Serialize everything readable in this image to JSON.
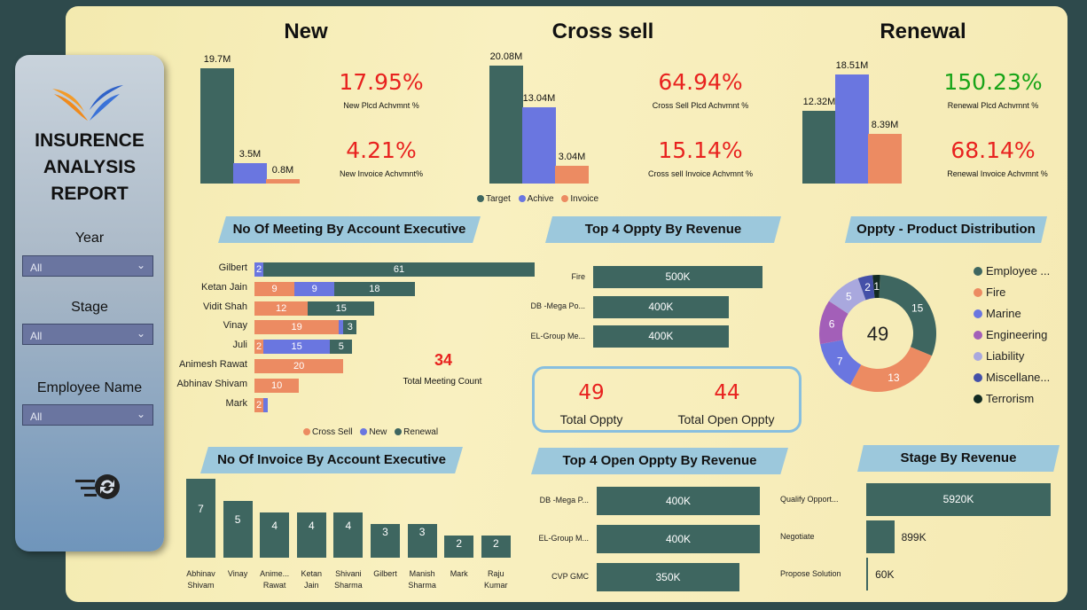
{
  "sidebar": {
    "title_lines": [
      "INSURENCE",
      "ANALYSIS",
      "REPORT"
    ],
    "filters": [
      {
        "label": "Year",
        "value": "All"
      },
      {
        "label": "Stage",
        "value": "All"
      },
      {
        "label": "Employee Name",
        "value": "All"
      }
    ],
    "logo_icon": "phoenix-logo",
    "reset_icon": "filter-reset-icon"
  },
  "kpi_sections": [
    {
      "title": "New",
      "bars": [
        {
          "label": "19.7M",
          "value": 19.7
        },
        {
          "label": "3.5M",
          "value": 3.5
        },
        {
          "label": "0.8M",
          "value": 0.8
        }
      ],
      "pct1": "17.95%",
      "pct1_label": "New Plcd Achvmnt %",
      "pct2": "4.21%",
      "pct2_label": "New Invoice Achvmnt%"
    },
    {
      "title": "Cross sell",
      "bars": [
        {
          "label": "20.08M",
          "value": 20.08
        },
        {
          "label": "13.04M",
          "value": 13.04
        },
        {
          "label": "3.04M",
          "value": 3.04
        }
      ],
      "pct1": "64.94%",
      "pct1_label": "Cross Sell Plcd Achvmnt %",
      "pct2": "15.14%",
      "pct2_label": "Cross sell Invoice Achvmnt %"
    },
    {
      "title": "Renewal",
      "bars": [
        {
          "label": "12.32M",
          "value": 12.32
        },
        {
          "label": "18.51M",
          "value": 18.51
        },
        {
          "label": "8.39M",
          "value": 8.39
        }
      ],
      "pct1": "150.23%",
      "pct1_label": "Renewal Plcd Achvmnt %",
      "pct2": "68.14%",
      "pct2_label": "Renewal Invoice Achvmnt %"
    }
  ],
  "kpi_legend": [
    "Target",
    "Achive",
    "Invoice"
  ],
  "colors": {
    "teal": "#3e6660",
    "blue": "#6a76e0",
    "orange": "#ec8b62",
    "red": "#e8221f",
    "green": "#18a418"
  },
  "meetings": {
    "title": "No Of Meeting By Account Executive",
    "rows": [
      {
        "name": "Gilbert",
        "cross": 0,
        "new": 2,
        "renewal": 61
      },
      {
        "name": "Ketan Jain",
        "cross": 9,
        "new": 9,
        "renewal": 18
      },
      {
        "name": "Vidit Shah",
        "cross": 12,
        "new": 0,
        "renewal": 15
      },
      {
        "name": "Vinay",
        "cross": 19,
        "new": 1,
        "renewal": 3
      },
      {
        "name": "Juli",
        "cross": 2,
        "new": 15,
        "renewal": 5
      },
      {
        "name": "Animesh Rawat",
        "cross": 20,
        "new": 0,
        "renewal": 0
      },
      {
        "name": "Abhinav Shivam",
        "cross": 10,
        "new": 0,
        "renewal": 0
      },
      {
        "name": "Mark",
        "cross": 2,
        "new": 1,
        "renewal": 0
      }
    ],
    "legend": [
      "Cross Sell",
      "New",
      "Renewal"
    ],
    "total": "34",
    "total_label": "Total Meeting Count"
  },
  "top4": {
    "title": "Top 4 Oppty By Revenue",
    "rows": [
      {
        "name": "Fire",
        "label": "500K",
        "value": 500
      },
      {
        "name": "DB -Mega Po...",
        "label": "400K",
        "value": 400
      },
      {
        "name": "EL-Group Me...",
        "label": "400K",
        "value": 400
      }
    ]
  },
  "oppty_card": {
    "total": "49",
    "total_label": "Total Oppty",
    "open": "44",
    "open_label": "Total Open Oppty"
  },
  "donut": {
    "title": "Oppty - Product Distribution",
    "center": "49",
    "slices": [
      {
        "name": "Employee ...",
        "value": 15,
        "color": "#3e6660"
      },
      {
        "name": "Fire",
        "value": 13,
        "color": "#ec8b62"
      },
      {
        "name": "Marine",
        "value": 7,
        "color": "#6a76e0"
      },
      {
        "name": "Engineering",
        "value": 6,
        "color": "#a35fb8"
      },
      {
        "name": "Liability",
        "value": 5,
        "color": "#a9a8de"
      },
      {
        "name": "Miscellane...",
        "value": 2,
        "color": "#4450a8"
      },
      {
        "name": "Terrorism",
        "value": 1,
        "color": "#122a22"
      }
    ]
  },
  "invoices": {
    "title": "No Of Invoice By Account Executive",
    "bars": [
      {
        "name": [
          "Abhinav",
          "Shivam"
        ],
        "value": 7
      },
      {
        "name": [
          "Vinay"
        ],
        "value": 5
      },
      {
        "name": [
          "Anime...",
          "Rawat"
        ],
        "value": 4
      },
      {
        "name": [
          "Ketan",
          "Jain"
        ],
        "value": 4
      },
      {
        "name": [
          "Shivani",
          "Sharma"
        ],
        "value": 4
      },
      {
        "name": [
          "Gilbert"
        ],
        "value": 3
      },
      {
        "name": [
          "Manish",
          "Sharma"
        ],
        "value": 3
      },
      {
        "name": [
          "Mark"
        ],
        "value": 2
      },
      {
        "name": [
          "Raju",
          "Kumar"
        ],
        "value": 2
      }
    ]
  },
  "top4open": {
    "title": "Top 4 Open Oppty By Revenue",
    "rows": [
      {
        "name": "DB -Mega P...",
        "label": "400K",
        "value": 400
      },
      {
        "name": "EL-Group M...",
        "label": "400K",
        "value": 400
      },
      {
        "name": "CVP GMC",
        "label": "350K",
        "value": 350
      }
    ]
  },
  "stage": {
    "title": "Stage By Revenue",
    "rows": [
      {
        "name": "Qualify Opport...",
        "label": "5920K",
        "value": 5920
      },
      {
        "name": "Negotiate",
        "label": "899K",
        "value": 899
      },
      {
        "name": "Propose Solution",
        "label": "60K",
        "value": 60
      }
    ]
  }
}
